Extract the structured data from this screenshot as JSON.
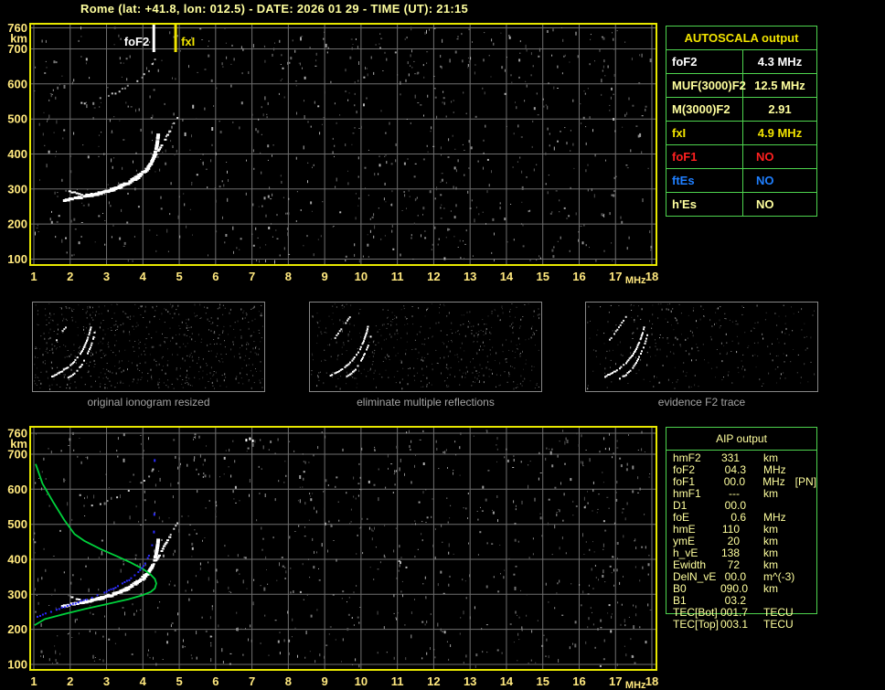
{
  "title": "Rome (lat: +41.8, lon: 012.5) - DATE: 2026 01 29 - TIME (UT): 21:15",
  "colors": {
    "frame_yellow": "#e8e800",
    "grid_gray": "#6f6f6f",
    "axis_label_yellow": "#ffe87e",
    "table_border_green": "#4ed44e",
    "pale_yellow": "#ffff9e",
    "bright_yellow": "#f2e400",
    "red": "#ff2020",
    "blue": "#1f7fff",
    "white": "#ffffff",
    "profile_green": "#00d23c",
    "trace_blue": "#2a2aff"
  },
  "axis": {
    "x_ticks": [
      1,
      2,
      3,
      4,
      5,
      6,
      7,
      8,
      9,
      10,
      11,
      12,
      13,
      14,
      15,
      16,
      17,
      18
    ],
    "x_unit": "MHz",
    "y_ticks": [
      760,
      700,
      600,
      500,
      400,
      300,
      200,
      100
    ],
    "y_unit": "km",
    "x_range": [
      1,
      18
    ],
    "y_range": [
      100,
      760
    ]
  },
  "markers": [
    {
      "id": "foF2",
      "label": "foF2",
      "freq": 4.3,
      "color": "#ffffff"
    },
    {
      "id": "fxI",
      "label": "fxI",
      "freq": 4.9,
      "color": "#f0e400"
    }
  ],
  "chart_data": {
    "type": "scatter",
    "title": "ionogram virtual height vs frequency",
    "xlabel": "MHz",
    "ylabel": "km",
    "xlim": [
      1,
      18
    ],
    "ylim": [
      100,
      760
    ],
    "trace_o": [
      [
        1.75,
        270
      ],
      [
        1.95,
        274
      ],
      [
        2.15,
        278
      ],
      [
        2.35,
        282
      ],
      [
        2.55,
        286
      ],
      [
        2.75,
        291
      ],
      [
        2.95,
        297
      ],
      [
        3.15,
        303
      ],
      [
        3.35,
        311
      ],
      [
        3.55,
        320
      ],
      [
        3.75,
        332
      ],
      [
        3.95,
        347
      ],
      [
        4.1,
        364
      ],
      [
        4.2,
        382
      ],
      [
        4.28,
        403
      ],
      [
        4.33,
        425
      ],
      [
        4.36,
        447
      ],
      [
        4.38,
        462
      ]
    ],
    "trace_x": [
      [
        1.95,
        296
      ],
      [
        2.15,
        290
      ],
      [
        2.35,
        286
      ],
      [
        2.55,
        288
      ],
      [
        2.75,
        292
      ],
      [
        2.95,
        298
      ],
      [
        3.15,
        305
      ],
      [
        3.35,
        313
      ],
      [
        3.55,
        323
      ],
      [
        3.75,
        336
      ],
      [
        3.95,
        352
      ],
      [
        4.15,
        372
      ],
      [
        4.3,
        395
      ],
      [
        4.45,
        420
      ],
      [
        4.58,
        445
      ],
      [
        4.68,
        462
      ],
      [
        4.73,
        472
      ]
    ],
    "second_hop": [
      [
        2.3,
        546
      ],
      [
        2.5,
        552
      ],
      [
        2.7,
        558
      ],
      [
        2.9,
        563
      ],
      [
        3.05,
        570
      ],
      [
        3.2,
        577
      ],
      [
        3.35,
        584
      ],
      [
        3.5,
        592
      ],
      [
        3.65,
        601
      ],
      [
        3.8,
        610
      ],
      [
        3.95,
        621
      ],
      [
        4.08,
        633
      ],
      [
        4.18,
        648
      ],
      [
        4.26,
        662
      ],
      [
        4.32,
        678
      ]
    ],
    "diag_dots": [
      [
        4.62,
        452
      ],
      [
        4.7,
        466
      ],
      [
        4.78,
        482
      ],
      [
        4.88,
        498
      ],
      [
        4.97,
        512
      ]
    ],
    "green_profile": [
      [
        1.02,
        212
      ],
      [
        1.3,
        229
      ],
      [
        1.85,
        244
      ],
      [
        2.4,
        258
      ],
      [
        3.0,
        272
      ],
      [
        3.6,
        286
      ],
      [
        4.0,
        298
      ],
      [
        4.22,
        307
      ],
      [
        4.33,
        317
      ],
      [
        4.37,
        331
      ],
      [
        4.33,
        344
      ],
      [
        4.2,
        358
      ],
      [
        4.02,
        371
      ],
      [
        3.66,
        391
      ],
      [
        3.3,
        408
      ],
      [
        2.86,
        428
      ],
      [
        2.4,
        452
      ],
      [
        2.12,
        472
      ],
      [
        1.84,
        512
      ],
      [
        1.54,
        562
      ],
      [
        1.24,
        616
      ],
      [
        1.05,
        672
      ]
    ],
    "blue_trace": [
      [
        1.0,
        236
      ],
      [
        1.3,
        248
      ],
      [
        1.6,
        259
      ],
      [
        1.9,
        269
      ],
      [
        2.2,
        280
      ],
      [
        2.5,
        291
      ],
      [
        2.8,
        303
      ],
      [
        3.1,
        316
      ],
      [
        3.35,
        329
      ],
      [
        3.6,
        344
      ],
      [
        3.8,
        360
      ],
      [
        3.95,
        378
      ],
      [
        4.08,
        398
      ],
      [
        4.17,
        420
      ],
      [
        4.23,
        442
      ],
      [
        4.27,
        460
      ]
    ],
    "blue_dots": [
      [
        4.28,
        482
      ],
      [
        4.29,
        532
      ],
      [
        4.3,
        686
      ]
    ],
    "top_specks": [
      [
        6.82,
        744
      ],
      [
        6.92,
        748
      ],
      [
        7.0,
        742
      ]
    ]
  },
  "noise": {
    "plot_top": {
      "seed": 11,
      "count": 880
    },
    "plot_bottom": {
      "seed": 29,
      "count": 900
    },
    "thumbs": [
      {
        "seed": 41,
        "count": 640
      },
      {
        "seed": 57,
        "count": 500
      },
      {
        "seed": 73,
        "count": 300
      }
    ]
  },
  "thumb_art": {
    "arc_a": [
      [
        20,
        80
      ],
      [
        28,
        76
      ],
      [
        36,
        71
      ],
      [
        43,
        65
      ],
      [
        49,
        58
      ],
      [
        54,
        50
      ],
      [
        58,
        41
      ],
      [
        61,
        32
      ],
      [
        63,
        24
      ]
    ],
    "arc_b": [
      [
        36,
        82
      ],
      [
        43,
        78
      ],
      [
        49,
        72
      ],
      [
        54,
        65
      ],
      [
        58,
        57
      ],
      [
        62,
        48
      ],
      [
        65,
        39
      ],
      [
        67,
        30
      ]
    ],
    "streak": [
      [
        25,
        40
      ],
      [
        30,
        33
      ],
      [
        35,
        26
      ],
      [
        40,
        19
      ],
      [
        44,
        13
      ]
    ]
  },
  "thumbnails": [
    {
      "caption": "original ionogram resized"
    },
    {
      "caption": "eliminate multiple reflections"
    },
    {
      "caption": "evidence F2 trace"
    }
  ],
  "autoscala_table": {
    "title": "AUTOSCALA output",
    "rows": [
      {
        "label": "foF2",
        "value": "4.3 MHz",
        "color": "#ffffff",
        "no": false
      },
      {
        "label": "MUF(3000)F2",
        "value": "12.5 MHz",
        "color": "#ffff9e",
        "no": false
      },
      {
        "label": "M(3000)F2",
        "value": "2.91",
        "color": "#ffff9e",
        "no": false
      },
      {
        "label": "fxI",
        "value": "4.9 MHz",
        "color": "#f2e400",
        "no": false
      },
      {
        "label": "foF1",
        "value": "NO",
        "color": "#ff2020",
        "no": true
      },
      {
        "label": "ftEs",
        "value": "NO",
        "color": "#1f7fff",
        "no": true
      },
      {
        "label": "h'Es",
        "value": "NO",
        "color": "#ffff9e",
        "no": true
      }
    ]
  },
  "aip_table": {
    "title": "AIP output",
    "rows": [
      {
        "label": "hmF2",
        "value": "331",
        "unit": "km",
        "extra": ""
      },
      {
        "label": "foF2",
        "value": "04.3",
        "unit": "MHz",
        "extra": ""
      },
      {
        "label": "foF1",
        "value": "00.0",
        "unit": "MHz",
        "extra": "[PN]"
      },
      {
        "label": "hmF1",
        "value": "---",
        "unit": "km",
        "extra": ""
      },
      {
        "label": "D1",
        "value": "00.0",
        "unit": "",
        "extra": ""
      },
      {
        "label": "foE",
        "value": "0.6",
        "unit": "MHz",
        "extra": ""
      },
      {
        "label": "hmE",
        "value": "110",
        "unit": "km",
        "extra": ""
      },
      {
        "label": "ymE",
        "value": "20",
        "unit": "km",
        "extra": ""
      },
      {
        "label": "h_vE",
        "value": "138",
        "unit": "km",
        "extra": ""
      },
      {
        "label": "Ewidth",
        "value": "72",
        "unit": "km",
        "extra": ""
      },
      {
        "label": "DelN_vE",
        "value": "00.0",
        "unit": "m^(-3)",
        "extra": ""
      },
      {
        "label": "B0",
        "value": "090.0",
        "unit": "km",
        "extra": ""
      },
      {
        "label": "B1",
        "value": "03.2",
        "unit": "",
        "extra": ""
      },
      {
        "label": "TEC[Bot]",
        "value": "001.7",
        "unit": "TECU",
        "extra": ""
      },
      {
        "label": "TEC[Top]",
        "value": "003.1",
        "unit": "TECU",
        "extra": ""
      }
    ]
  }
}
